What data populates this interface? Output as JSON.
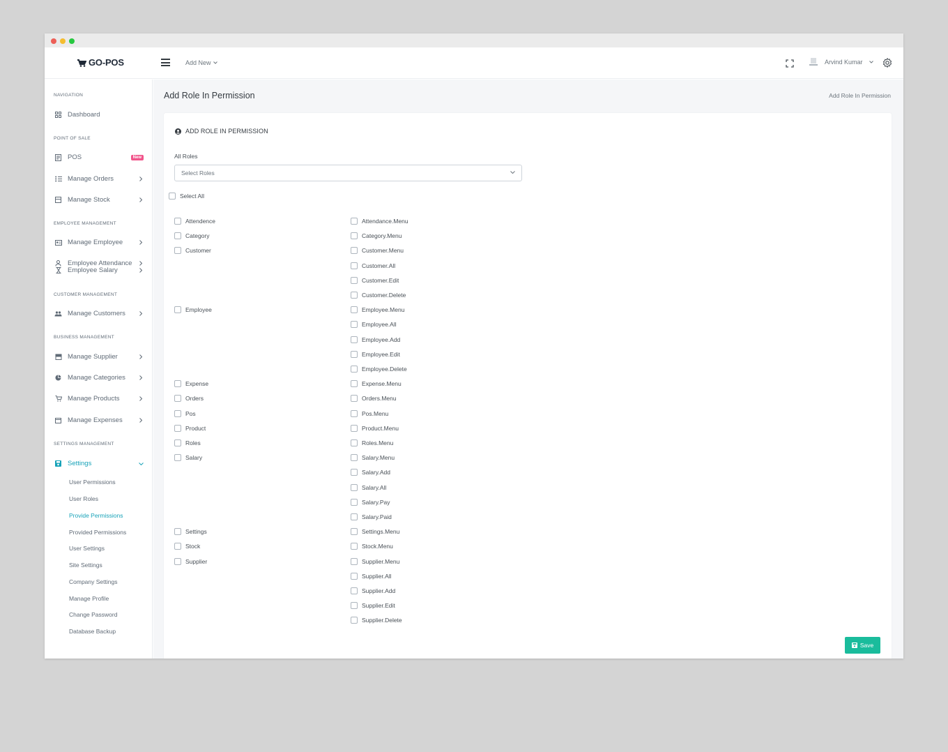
{
  "app": {
    "logo_text": "GO-POS"
  },
  "topbar": {
    "add_new": "Add New",
    "user_name": "Arvind Kumar"
  },
  "sidebar": {
    "sections": [
      "NAVIGATION",
      "POINT OF SALE",
      "EMPLOYEE MANAGEMENT",
      "CUSTOMER MANAGEMENT",
      "BUSINESS MANAGEMENT",
      "SETTINGS MANAGEMENT"
    ],
    "items": {
      "dashboard": "Dashboard",
      "pos": "POS",
      "pos_badge": "New",
      "manage_orders": "Manage Orders",
      "manage_stock": "Manage Stock",
      "manage_employee": "Manage Employee",
      "employee_attendance": "Employee Attendance",
      "employee_salary": "Employee Salary",
      "manage_customers": "Manage Customers",
      "manage_supplier": "Manage Supplier",
      "manage_categories": "Manage Categories",
      "manage_products": "Manage Products",
      "manage_expenses": "Manage Expenses",
      "settings": "Settings"
    },
    "settings_sub": [
      "User Permissions",
      "User Roles",
      "Provide Permissions",
      "Provided Permissions",
      "User Settings",
      "Site Settings",
      "Company Settings",
      "Manage Profile",
      "Change Password",
      "Database Backup"
    ]
  },
  "page": {
    "title": "Add Role In Permission",
    "breadcrumb": "Add Role In Permission",
    "card_title": "ADD ROLE IN PERMISSION",
    "roles_label": "All Roles",
    "roles_placeholder": "Select Roles",
    "select_all": "Select All",
    "save": "Save"
  },
  "groups": [
    "Attendence",
    "Category",
    "Customer",
    "Employee",
    "Expense",
    "Orders",
    "Pos",
    "Product",
    "Roles",
    "Salary",
    "Settings",
    "Stock",
    "Supplier"
  ],
  "permissions": [
    "Attendance.Menu",
    "Category.Menu",
    "Customer.Menu",
    "Customer.All",
    "Customer.Edit",
    "Customer.Delete",
    "Employee.Menu",
    "Employee.All",
    "Employee.Add",
    "Employee.Edit",
    "Employee.Delete",
    "Expense.Menu",
    "Orders.Menu",
    "Pos.Menu",
    "Product.Menu",
    "Roles.Menu",
    "Salary.Menu",
    "Salary.Add",
    "Salary.All",
    "Salary.Pay",
    "Salary.Paid",
    "Settings.Menu",
    "Stock.Menu",
    "Supplier.Menu",
    "Supplier.All",
    "Supplier.Add",
    "Supplier.Edit",
    "Supplier.Delete"
  ],
  "colors": {
    "accent": "#17a2b8",
    "save": "#1abc9c",
    "badge": "#f1558b"
  }
}
